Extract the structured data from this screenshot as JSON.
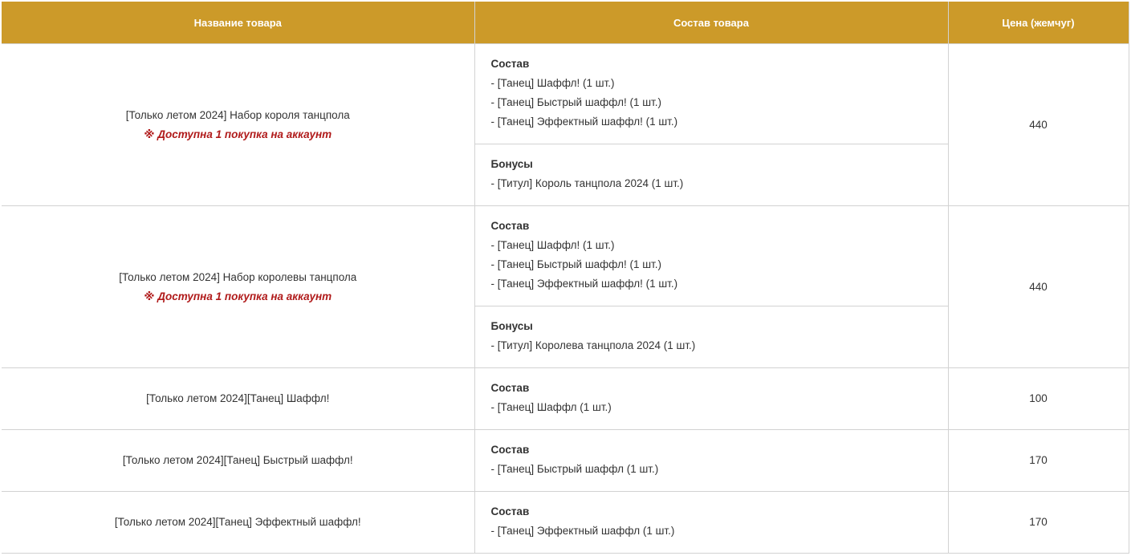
{
  "table": {
    "headers": {
      "name": "Название товара",
      "composition": "Состав товара",
      "price": "Цена (жемчуг)"
    },
    "accent_color": "#cc9a29",
    "note_color": "#b01a1a",
    "rows": [
      {
        "name": "[Только летом 2024] Набор короля танцпола",
        "note": "※ Доступна 1 покупка на аккаунт",
        "composition_title": "Состав",
        "composition_items": [
          "- [Танец] Шаффл! (1 шт.)",
          "- [Танец] Быстрый шаффл! (1 шт.)",
          "- [Танец] Эффектный шаффл! (1 шт.)"
        ],
        "bonus_title": "Бонусы",
        "bonus_items": [
          "- [Титул] Король танцпола 2024 (1 шт.)"
        ],
        "price": "440"
      },
      {
        "name": "[Только летом 2024] Набор королевы танцпола",
        "note": "※ Доступна 1 покупка на аккаунт",
        "composition_title": "Состав",
        "composition_items": [
          "- [Танец] Шаффл! (1 шт.)",
          "- [Танец] Быстрый шаффл! (1 шт.)",
          "- [Танец] Эффектный шаффл! (1 шт.)"
        ],
        "bonus_title": "Бонусы",
        "bonus_items": [
          "- [Титул] Королева танцпола 2024 (1 шт.)"
        ],
        "price": "440"
      },
      {
        "name": "[Только летом 2024][Танец] Шаффл!",
        "composition_title": "Состав",
        "composition_items": [
          "- [Танец] Шаффл (1 шт.)"
        ],
        "price": "100"
      },
      {
        "name": "[Только летом 2024][Танец] Быстрый шаффл!",
        "composition_title": "Состав",
        "composition_items": [
          "- [Танец] Быстрый шаффл (1 шт.)"
        ],
        "price": "170"
      },
      {
        "name": "[Только летом 2024][Танец] Эффектный шаффл!",
        "composition_title": "Состав",
        "composition_items": [
          "- [Танец] Эффектный шаффл (1 шт.)"
        ],
        "price": "170"
      }
    ]
  }
}
